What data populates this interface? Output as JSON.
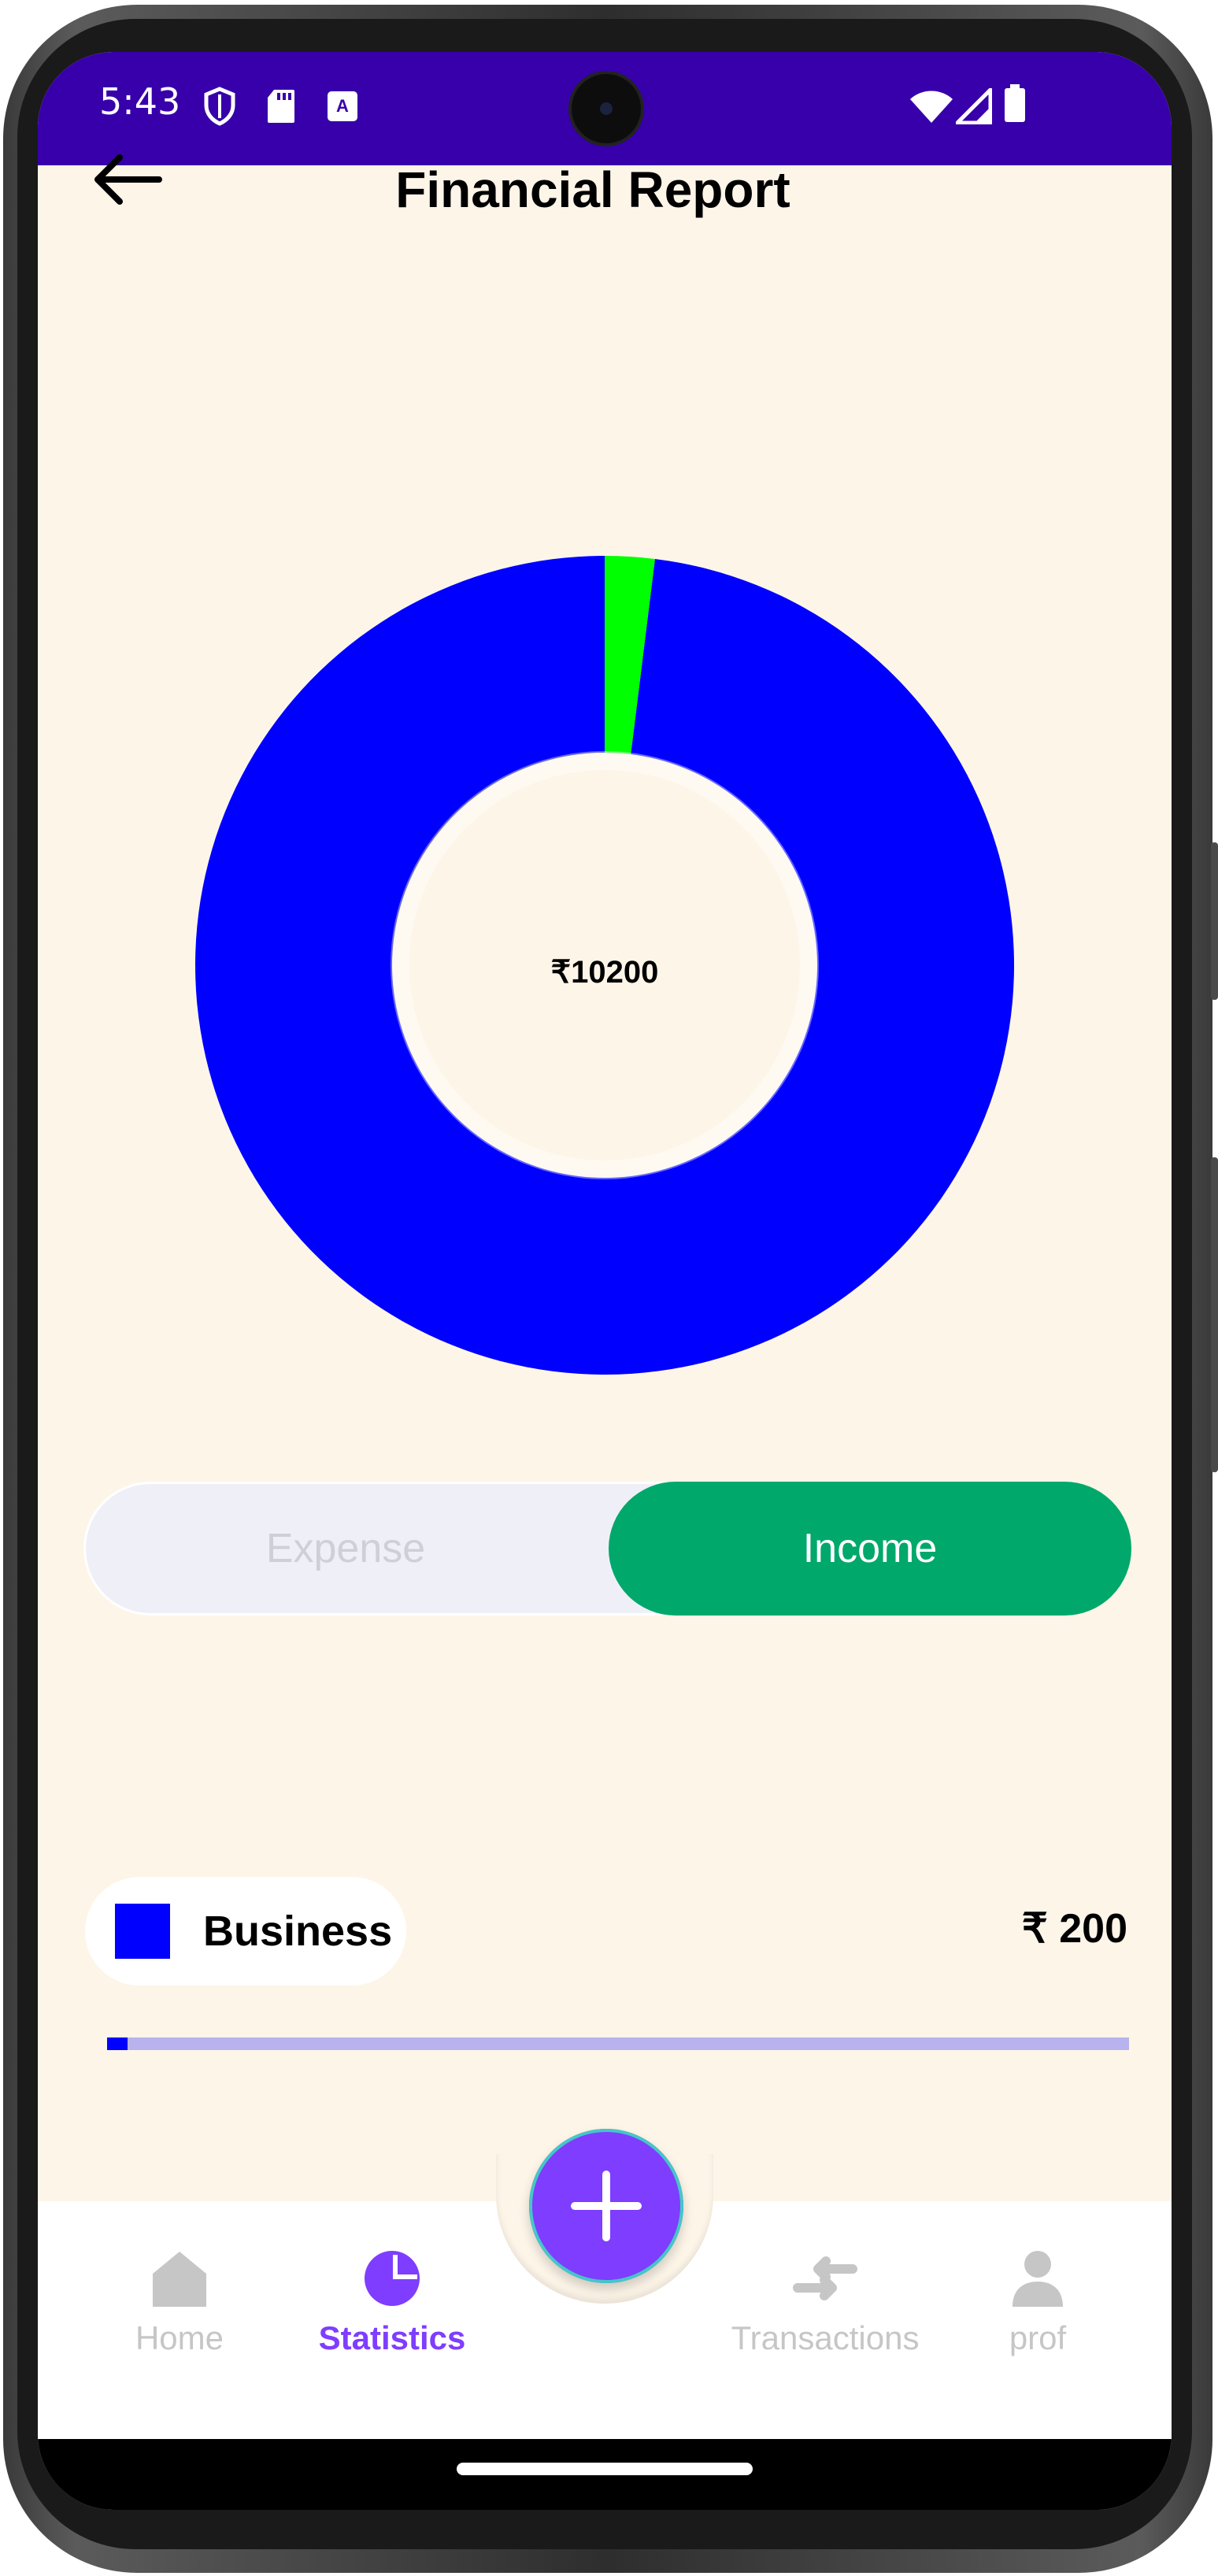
{
  "status_bar": {
    "time": "5:43",
    "background": "#3800aa",
    "left_icons": [
      "shield-icon",
      "sd-card-icon",
      "keyboard-a-icon"
    ],
    "right_icons": [
      "wifi-icon",
      "signal-icon",
      "battery-icon"
    ]
  },
  "header": {
    "title": "Financial Report",
    "back_icon": "arrow-left-icon"
  },
  "chart_data": {
    "type": "pie",
    "center_label": "₹10200",
    "slices": [
      {
        "value": 10000,
        "color": "#0000ff"
      },
      {
        "value": 200,
        "color": "#00ff00"
      }
    ]
  },
  "toggle": {
    "options": [
      "Expense",
      "Income"
    ],
    "selected": "Income",
    "selected_color": "#00a86b"
  },
  "categories": [
    {
      "name": "Business",
      "amount": "₹ 200",
      "color": "#0000ff",
      "progress": 0.02
    }
  ],
  "fab": {
    "icon": "plus-icon",
    "color": "#7f3dff"
  },
  "bottom_nav": {
    "items": [
      {
        "label": "Home",
        "icon": "home-icon",
        "active": false
      },
      {
        "label": "Statistics",
        "icon": "pie-chart-icon",
        "active": true
      },
      {
        "label": "Transactions",
        "icon": "transfer-arrows-icon",
        "active": false
      },
      {
        "label": "prof",
        "icon": "person-icon",
        "active": false
      }
    ],
    "active_color": "#7f3dff",
    "inactive_color": "#c6c6c6"
  }
}
